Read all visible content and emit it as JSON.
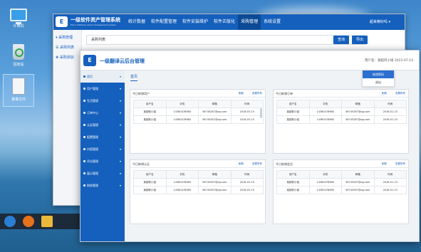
{
  "desktop": {
    "icons": [
      {
        "label": "计算机",
        "icon": "computer-icon"
      },
      {
        "label": "回收站",
        "icon": "recycle-bin-icon"
      },
      {
        "label": "谁谁文件",
        "icon": "document-icon"
      }
    ]
  },
  "back_window": {
    "app_title": "一级软件资产管理系统",
    "app_subtitle": "Eisco Software asset management system",
    "nav": [
      "统计数据",
      "软件配置管理",
      "软件安装维护",
      "软件正版化",
      "采购管理",
      "系统设置"
    ],
    "active_nav": "采购管理",
    "user": "超来嘛好吗 ▾",
    "sidebar": [
      "▾ 采购管理",
      "☰ 采购列表",
      "✚ 采购添加"
    ],
    "breadcrumb": "采购列表",
    "buttons": {
      "query": "查询",
      "export": "导出"
    }
  },
  "front_window": {
    "app_title": "一级翻译云后台管理",
    "user_info": "用户名：某超内小组    2015-07-14",
    "dropdown": [
      "修改密码",
      "退出"
    ],
    "tab": "首页",
    "sidebar": [
      "首页",
      "用户管理",
      "生活管理",
      "订单中心",
      "认证管理",
      "配置管理",
      "内容管理",
      "评论管理",
      "展示管理",
      "财经管理"
    ],
    "panels": [
      {
        "title": "今日新增用户",
        "links": [
          "刷新",
          "查看所有"
        ],
        "columns": [
          "用户名",
          "手机",
          "邮箱",
          "时间"
        ],
        "rows": [
          [
            "某超软小组",
            "14360478980",
            "56745267@qq.com",
            "2016-03-15"
          ],
          [
            "某超软小组",
            "14360478980",
            "56745267@qq.com",
            "2016-03-15"
          ]
        ]
      },
      {
        "title": "今日新增订单",
        "links": [
          "刷新",
          "查看所有"
        ],
        "columns": [
          "用户名",
          "手机",
          "邮箱",
          "时间"
        ],
        "rows": [
          [
            "某超软小组",
            "14360478980",
            "56745267@qq.com",
            "2016-01-15"
          ],
          [
            "某超软小组",
            "14360478980",
            "56745267@qq.com",
            "2016-01-15"
          ]
        ]
      },
      {
        "title": "今日新增认证",
        "links": [
          "刷新",
          "查看所有"
        ],
        "columns": [
          "用户名",
          "手机",
          "邮箱",
          "时间"
        ],
        "rows": [
          [
            "某超软小组",
            "14360478980",
            "56745267@qq.com",
            "2016-03-15"
          ],
          [
            "某超软小组",
            "14360478980",
            "56745267@qq.com",
            "2016-03-15"
          ]
        ]
      },
      {
        "title": "今日新增会员",
        "links": [
          "刷新",
          "查看所有"
        ],
        "columns": [
          "用户名",
          "手机",
          "邮箱",
          "时间"
        ],
        "rows": [
          [
            "某超软小组",
            "14360478980",
            "56745267@qq.com",
            "2016-01-15"
          ],
          [
            "某超软小组",
            "14360478980",
            "56745267@qq.com",
            "2016-01-15"
          ]
        ]
      }
    ]
  },
  "colors": {
    "brand_blue": "#1560bd",
    "nav_active": "#0c4a96"
  }
}
